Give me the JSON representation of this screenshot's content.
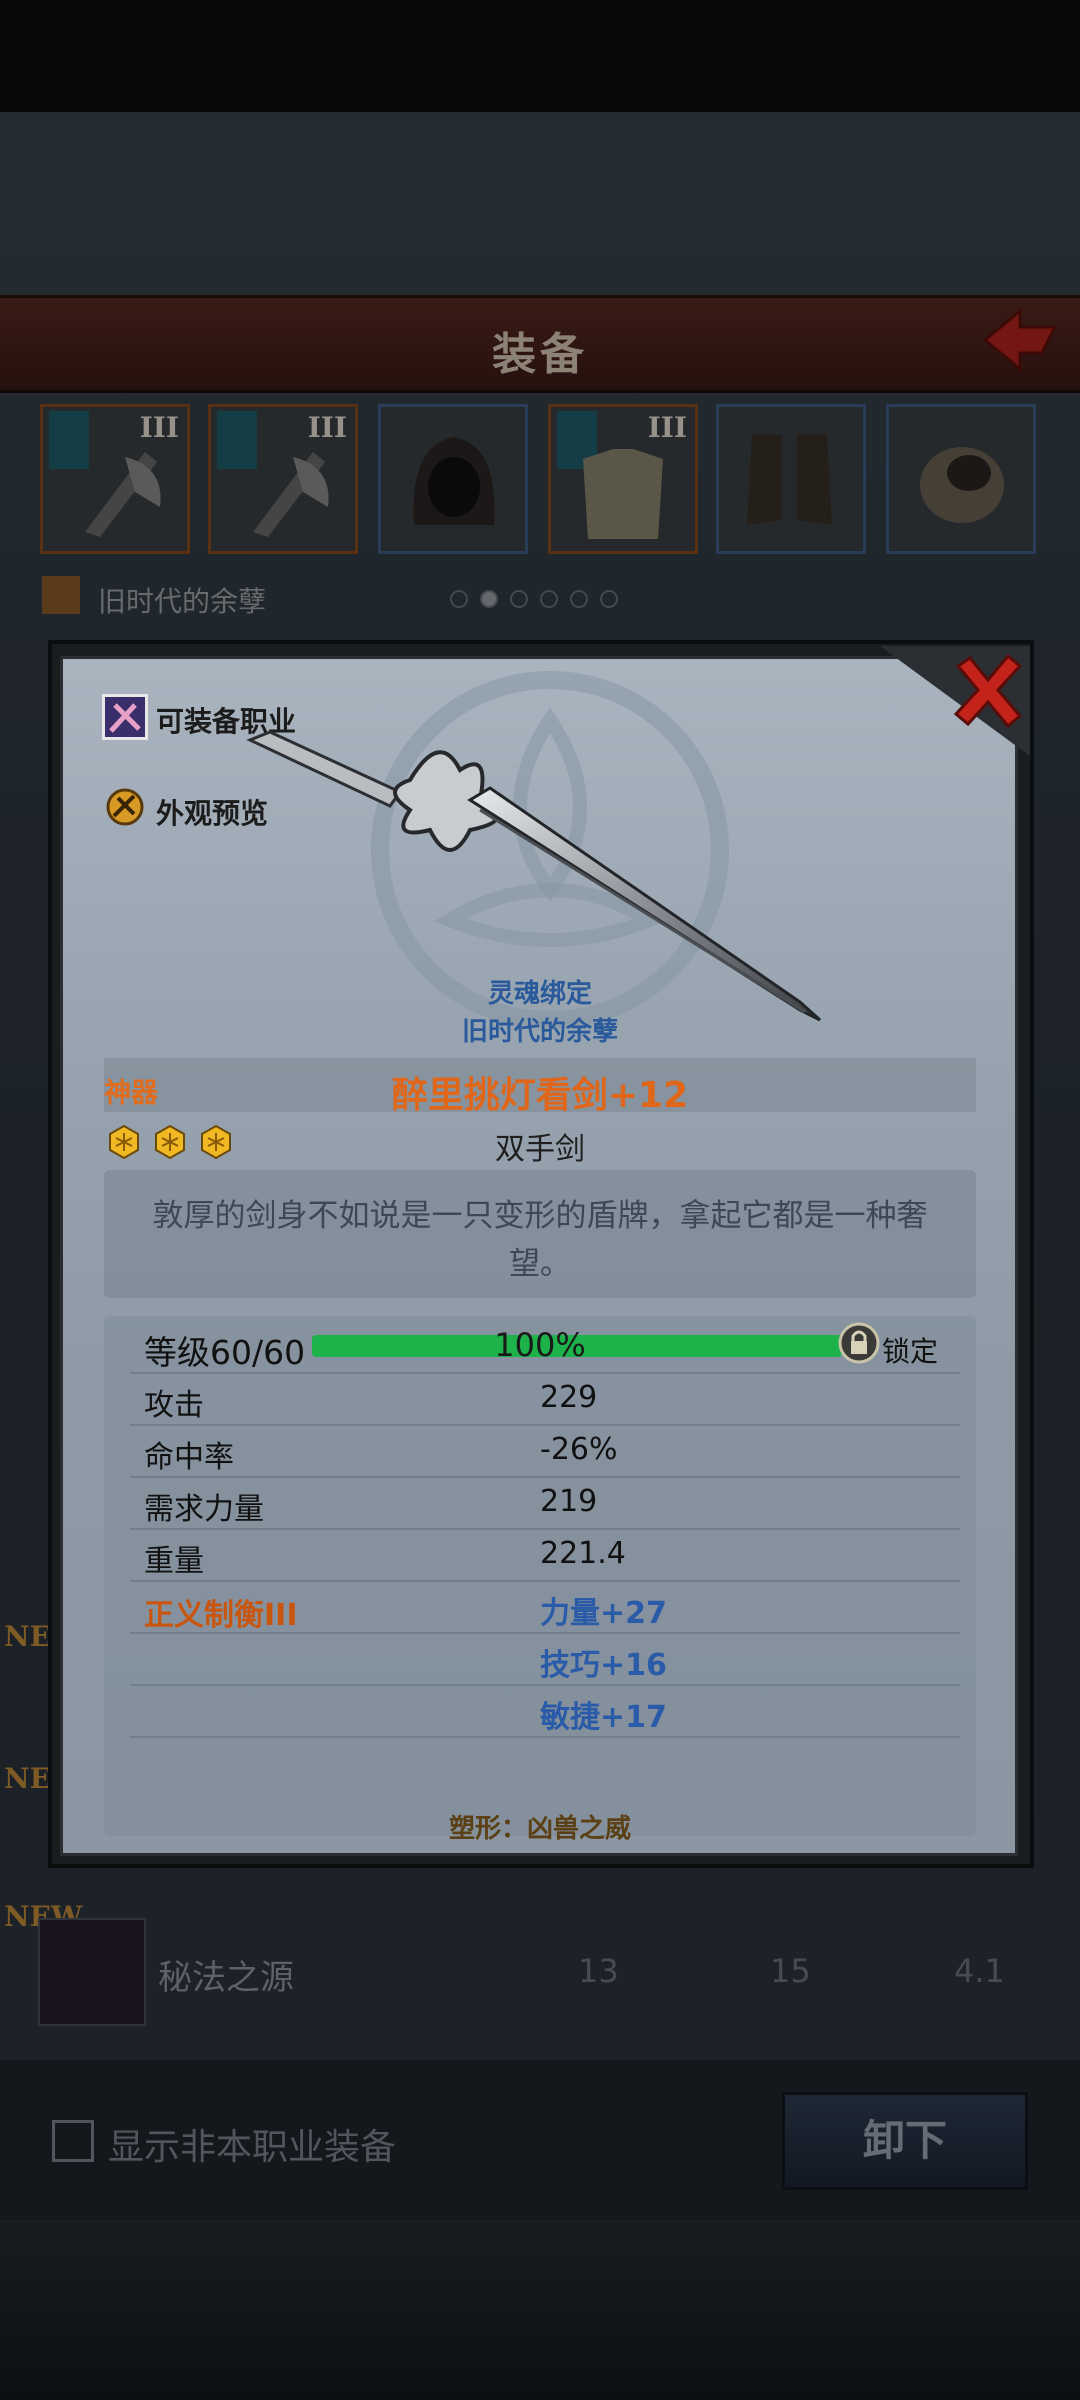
{
  "screen": {
    "title": "装备",
    "set_name_line": "旧时代的余孽",
    "slots": [
      {
        "tier": "III",
        "border": "orange"
      },
      {
        "tier": "III",
        "border": "orange"
      },
      {
        "tier": "",
        "border": "blue"
      },
      {
        "tier": "III",
        "border": "orange"
      },
      {
        "tier": "",
        "border": "blue"
      },
      {
        "tier": "",
        "border": "blue"
      }
    ],
    "page_dots": 6,
    "active_dot": 1,
    "list": {
      "new_badge": "NEW",
      "row": {
        "name": "秘法之源",
        "v1": "13",
        "v2": "15",
        "v3": "4.1"
      }
    },
    "show_other_class_label": "显示非本职业装备",
    "show_other_class_checked": false,
    "unequip_label": "卸下"
  },
  "dialog": {
    "equip_class_label": "可装备职业",
    "appearance_preview_label": "外观预览",
    "soulbound": "灵魂绑定",
    "set_name": "旧时代的余孽",
    "rarity": "神器",
    "item_name": "醉里挑灯看剑+12",
    "stars": 3,
    "item_type": "双手剑",
    "description": "敦厚的剑身不如说是一只变形的盾牌，拿起它都是一种奢望。",
    "level": {
      "label": "等级60/60",
      "progress_percent": 100,
      "progress_text": "100%",
      "lock_label": "锁定"
    },
    "stats": [
      {
        "label": "攻击",
        "value": "229"
      },
      {
        "label": "命中率",
        "value": "-26%"
      },
      {
        "label": "需求力量",
        "value": "219"
      },
      {
        "label": "重量",
        "value": "221.4"
      }
    ],
    "set_bonus": {
      "label": "正义制衡III",
      "values": [
        "力量+27",
        "技巧+16",
        "敏捷+17"
      ]
    },
    "shape": "塑形：凶兽之威"
  },
  "colors": {
    "rarity": "#e0661a",
    "bonus": "#2a5ba8",
    "progress": "#1db24a",
    "set_label": "#c8560f"
  }
}
